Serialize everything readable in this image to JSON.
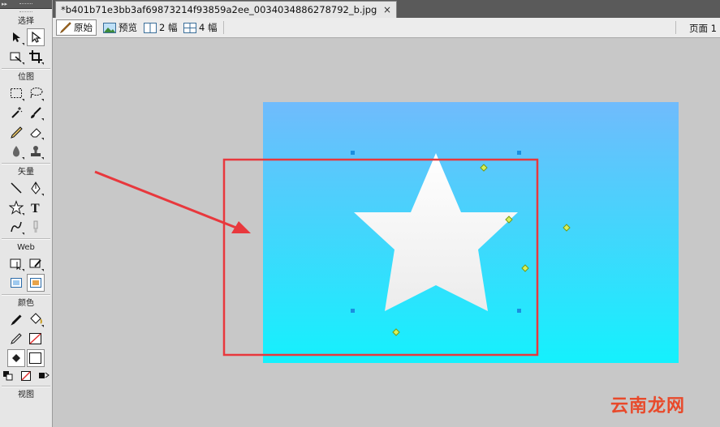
{
  "toolbox": {
    "sections": {
      "select": "选择",
      "bitmap": "位图",
      "vector": "矢量",
      "web": "Web",
      "colors": "颜色",
      "view": "视图"
    }
  },
  "tabbar": {
    "file_name": "*b401b71e3bb3af69873214f93859a2ee_0034034886278792_b.jpg",
    "close_glyph": "×"
  },
  "viewbar": {
    "original": "原始",
    "preview": "预览",
    "two_up": "2 幅",
    "four_up": "4 幅",
    "page": "页面 1"
  },
  "canvas": {
    "gradient_colors": [
      "#70bbfc",
      "#14f1fd"
    ],
    "star_color": "#f4f4f4",
    "highlight_color": "#e8383d"
  },
  "watermark": {
    "text": "云南龙网"
  }
}
